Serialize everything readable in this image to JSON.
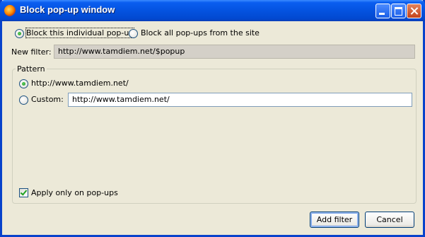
{
  "window": {
    "title": "Block pop-up window",
    "icon": "firefox-icon"
  },
  "mode": {
    "option_individual": "Block this individual pop-up",
    "option_all": "Block all pop-ups from the site",
    "selected": "individual"
  },
  "new_filter": {
    "label": "New filter:",
    "value": "http://www.tamdiem.net/$popup"
  },
  "pattern": {
    "group_title": "Pattern",
    "option_site": "http://www.tamdiem.net/",
    "custom_label": "Custom:",
    "custom_value": "http://www.tamdiem.net/",
    "selected": "site"
  },
  "apply_only_popups": {
    "label": "Apply only on pop-ups",
    "checked": true
  },
  "buttons": {
    "add_filter": "Add filter",
    "cancel": "Cancel"
  },
  "colors": {
    "titlebar": "#0453e0",
    "dialog_bg": "#ece9d8",
    "radio_dot": "#21a121"
  }
}
